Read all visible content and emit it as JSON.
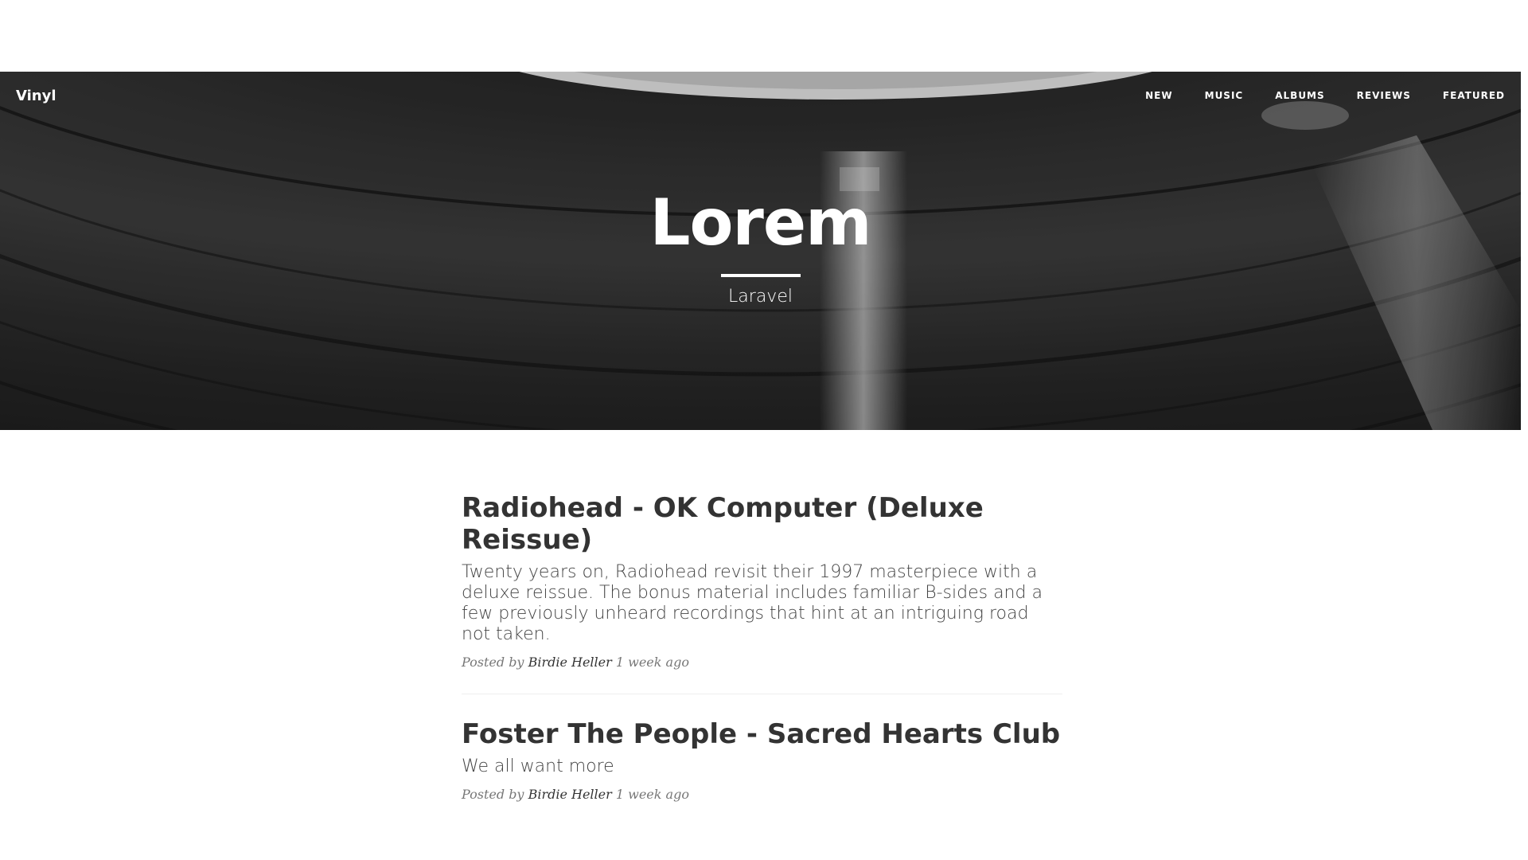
{
  "navbar": {
    "brand": "Vinyl",
    "items": [
      {
        "label": "NEW"
      },
      {
        "label": "MUSIC"
      },
      {
        "label": "ALBUMS"
      },
      {
        "label": "REVIEWS"
      },
      {
        "label": "FEATURED"
      }
    ]
  },
  "hero": {
    "title": "Lorem",
    "subtitle": "Laravel"
  },
  "posts": [
    {
      "title": "Radiohead - OK Computer (Deluxe Reissue)",
      "excerpt": "Twenty years on, Radiohead revisit their 1997 masterpiece with a deluxe reissue. The bonus material includes familiar B-sides and a few previously unheard recordings that hint at an intriguing road not taken.",
      "meta_prefix": "Posted by",
      "author": "Birdie Heller",
      "time": "1 week ago"
    },
    {
      "title": "Foster The People - Sacred Hearts Club",
      "excerpt": "We all want more",
      "meta_prefix": "Posted by",
      "author": "Birdie Heller",
      "time": "1 week ago"
    }
  ],
  "colors": {
    "hero_bg": "#2b2b2b",
    "text": "#333333",
    "meta": "#777777",
    "divider": "#eeeeee"
  }
}
